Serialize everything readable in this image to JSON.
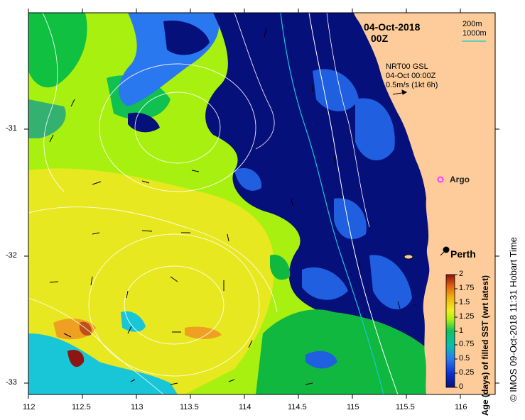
{
  "header": {
    "date": "04-Oct-2018",
    "time": "00Z"
  },
  "legend_top": {
    "depth_200": "200m",
    "depth_1000": "1000m",
    "depth_1000_color": "#2fd1c4"
  },
  "current_info": {
    "line1": "NRT00 GSL",
    "line2": "04-Oct 00:00Z",
    "line3": "0.5m/s (1kt 6h)"
  },
  "markers": {
    "argo_label": "Argo",
    "argo_color": "#ff3cff",
    "city_label": "Perth"
  },
  "x_ticks": [
    "112",
    "112.5",
    "113",
    "113.5",
    "114",
    "114.5",
    "115",
    "115.5",
    "116"
  ],
  "y_ticks": [
    "-31",
    "-32",
    "-33"
  ],
  "colorbar": {
    "title": "Age (days) of filled SST (wrt latest)",
    "ticks": [
      "0",
      "0.25",
      "0.5",
      "0.75",
      "1",
      "1.25",
      "1.5",
      "1.75",
      "2"
    ],
    "colors": [
      "#08127a",
      "#0a2fd0",
      "#2a78f0",
      "#0abfb0",
      "#10c060",
      "#a8f010",
      "#f0f020",
      "#f0b010",
      "#e06010",
      "#901010"
    ]
  },
  "credit": "© IMOS 09-Oct-2018 11:31 Hobart Time",
  "colors": {
    "land": "#fdcc9a",
    "deep_blue": "#06107a",
    "mid_blue": "#1f5fe0",
    "green": "#10b840",
    "yellow_green": "#a8f010",
    "yellow": "#e8e820",
    "cyan": "#19c6d8",
    "orange": "#f0a020",
    "dark_red": "#8e1510"
  }
}
